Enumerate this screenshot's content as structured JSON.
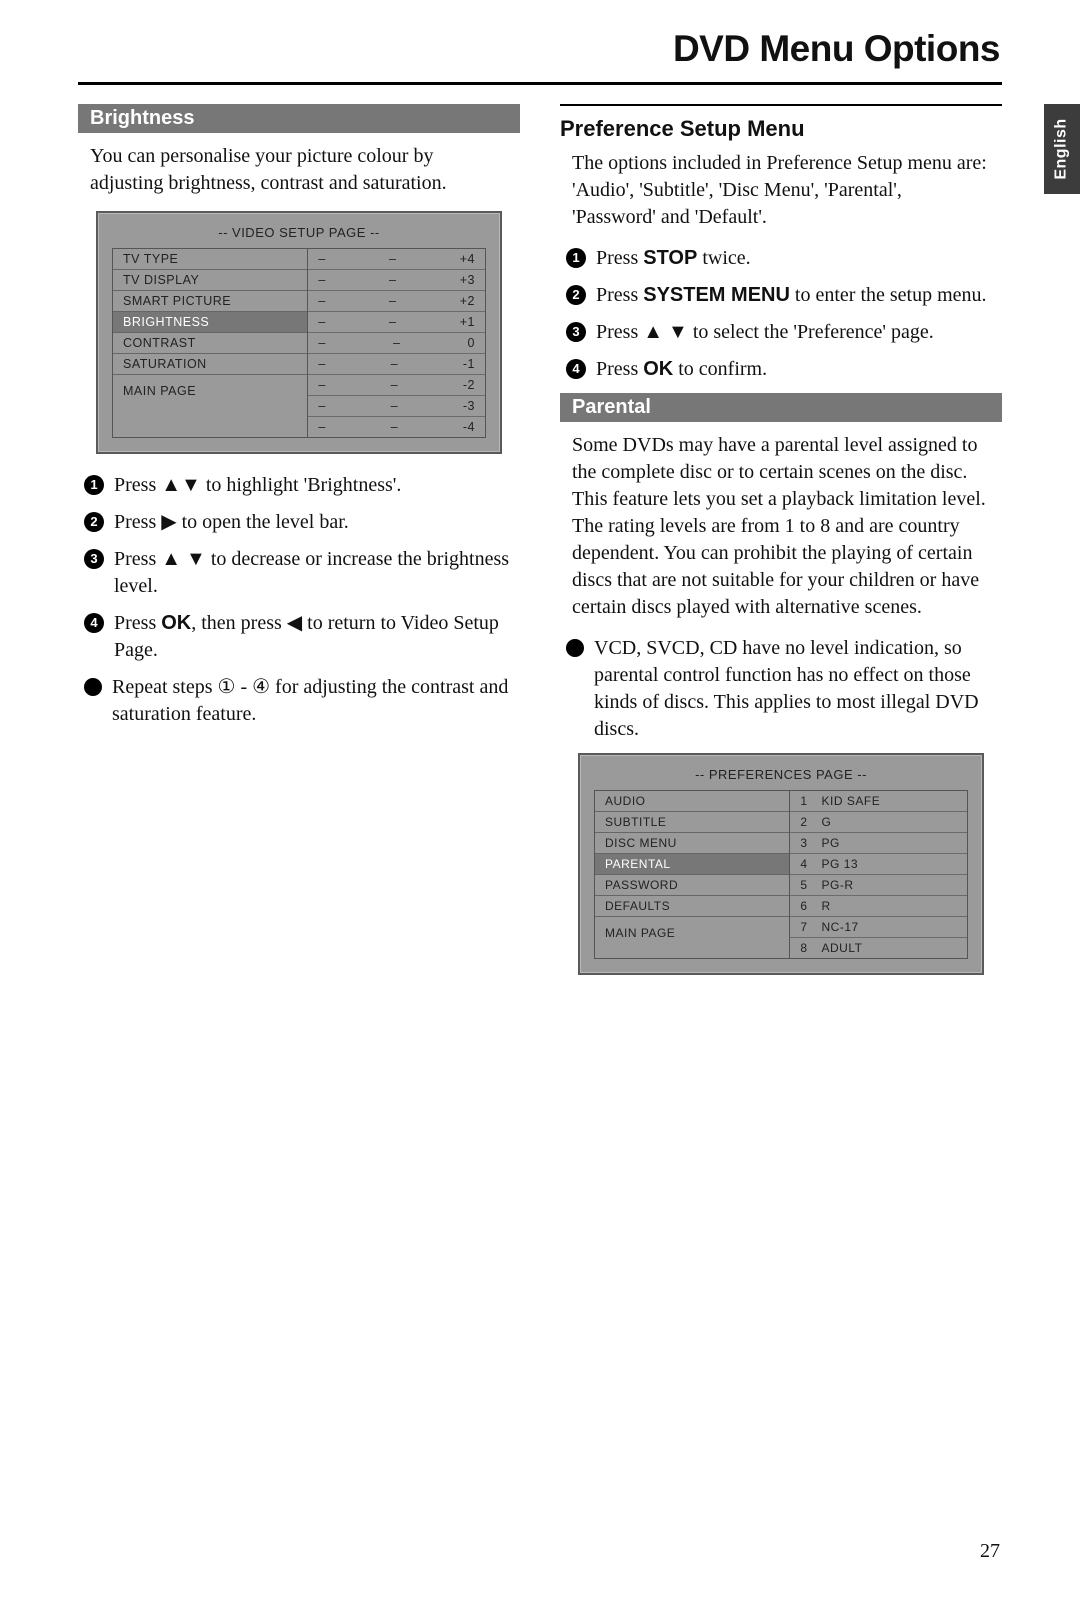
{
  "page_title": "DVD Menu Options",
  "language_tab": "English",
  "page_number": "27",
  "left": {
    "section_header": "Brightness",
    "intro": "You can personalise your picture colour by adjusting brightness, contrast and saturation.",
    "osd": {
      "title": "-- VIDEO SETUP PAGE --",
      "items": [
        "TV TYPE",
        "TV DISPLAY",
        "SMART PICTURE",
        "BRIGHTNESS",
        "CONTRAST",
        "SATURATION"
      ],
      "selected_index": 3,
      "main_page": "MAIN PAGE",
      "values": [
        "+4",
        "+3",
        "+2",
        "+1",
        "0",
        "-1",
        "-2",
        "-3",
        "-4"
      ]
    },
    "steps": [
      {
        "type": "num",
        "n": "1",
        "html": "Press ▲▼ to highlight 'Brightness'."
      },
      {
        "type": "num",
        "n": "2",
        "html": "Press ▶ to open the level bar."
      },
      {
        "type": "num",
        "n": "3",
        "html": "Press ▲ ▼ to decrease or increase the brightness level."
      },
      {
        "type": "num",
        "n": "4",
        "html": "Press <b class='sans'>OK</b>, then press ◀ to return to Video Setup Page."
      },
      {
        "type": "bullet",
        "html": "Repeat steps ① - ④ for adjusting the contrast and saturation feature."
      }
    ]
  },
  "right": {
    "section_title": "Preference Setup Menu",
    "intro": "The options included in Preference Setup menu are: 'Audio', 'Subtitle', 'Disc Menu', 'Parental', 'Password' and 'Default'.",
    "steps": [
      {
        "type": "num",
        "n": "1",
        "html": "Press <b class='sans'>STOP</b> twice."
      },
      {
        "type": "num",
        "n": "2",
        "html": "Press <b class='sans'>SYSTEM MENU</b> to enter the setup menu."
      },
      {
        "type": "num",
        "n": "3",
        "html": "Press ▲ ▼ to select the 'Preference' page."
      },
      {
        "type": "num",
        "n": "4",
        "html": "Press <b class='sans'>OK</b> to confirm."
      }
    ],
    "sub_header": "Parental",
    "parental_text": "Some DVDs may have a parental level assigned to the complete disc or to certain scenes on the disc. This feature lets you set a playback limitation level. The rating levels are from 1 to 8 and are country dependent. You can prohibit the playing of certain discs that are not suitable for your children or have certain discs played with alternative scenes.",
    "note": [
      {
        "type": "bullet",
        "html": "VCD, SVCD, CD have no level indication, so parental control function has no effect on those kinds of discs. This applies to most illegal DVD discs."
      }
    ],
    "osd": {
      "title": "-- PREFERENCES PAGE --",
      "items": [
        "AUDIO",
        "SUBTITLE",
        "DISC MENU",
        "PARENTAL",
        "PASSWORD",
        "DEFAULTS"
      ],
      "selected_index": 3,
      "main_page": "MAIN PAGE",
      "values": [
        {
          "n": "1",
          "label": "KID SAFE"
        },
        {
          "n": "2",
          "label": "G"
        },
        {
          "n": "3",
          "label": "PG"
        },
        {
          "n": "4",
          "label": "PG 13"
        },
        {
          "n": "5",
          "label": "PG-R"
        },
        {
          "n": "6",
          "label": "R"
        },
        {
          "n": "7",
          "label": "NC-17"
        },
        {
          "n": "8",
          "label": "ADULT"
        }
      ]
    }
  }
}
